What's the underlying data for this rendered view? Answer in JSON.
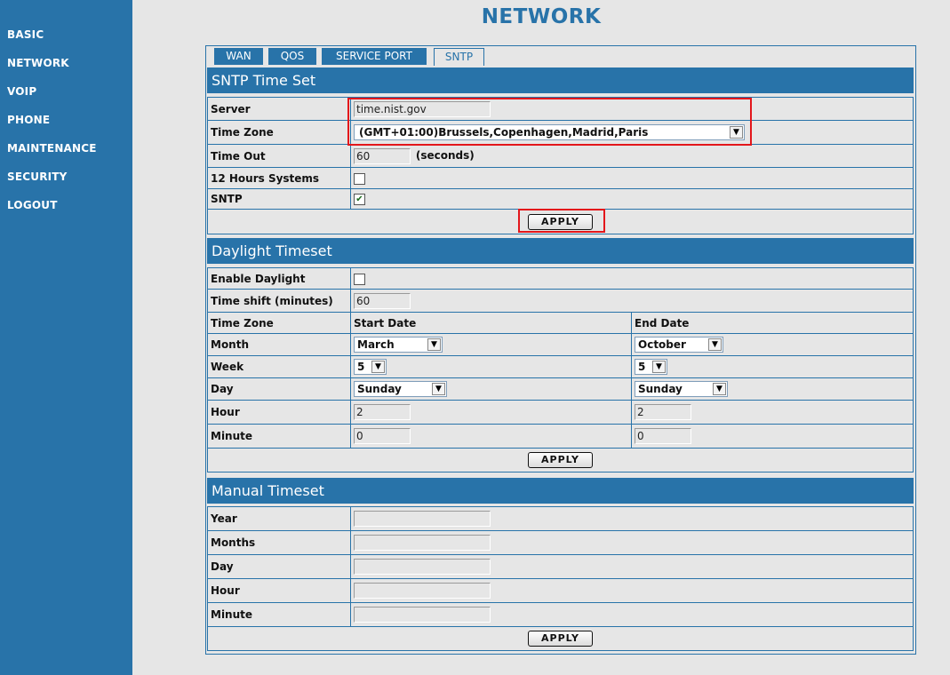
{
  "page_title": "NETWORK",
  "sidebar": {
    "items": [
      "BASIC",
      "NETWORK",
      "VOIP",
      "PHONE",
      "MAINTENANCE",
      "SECURITY",
      "LOGOUT"
    ]
  },
  "tabs": [
    {
      "label": "WAN",
      "active": false
    },
    {
      "label": "QOS",
      "active": false
    },
    {
      "label": "SERVICE PORT",
      "active": false
    },
    {
      "label": "SNTP",
      "active": true
    }
  ],
  "sntp": {
    "title": "SNTP Time Set",
    "server_label": "Server",
    "server_value": "time.nist.gov",
    "timezone_label": "Time Zone",
    "timezone_value": "(GMT+01:00)Brussels,Copenhagen,Madrid,Paris",
    "timeout_label": "Time Out",
    "timeout_value": "60",
    "timeout_unit": "(seconds)",
    "twelve_hours_label": "12 Hours Systems",
    "twelve_hours_checked": false,
    "sntp_label": "SNTP",
    "sntp_checked": true,
    "apply_label": "APPLY"
  },
  "daylight": {
    "title": "Daylight Timeset",
    "enable_label": "Enable Daylight",
    "enable_checked": false,
    "shift_label": "Time shift (minutes)",
    "shift_value": "60",
    "tz_label": "Time Zone",
    "start_header": "Start Date",
    "end_header": "End Date",
    "month_label": "Month",
    "start_month": "March",
    "end_month": "October",
    "week_label": "Week",
    "start_week": "5",
    "end_week": "5",
    "day_label": "Day",
    "start_day": "Sunday",
    "end_day": "Sunday",
    "hour_label": "Hour",
    "start_hour": "2",
    "end_hour": "2",
    "minute_label": "Minute",
    "start_minute": "0",
    "end_minute": "0",
    "apply_label": "APPLY"
  },
  "manual": {
    "title": "Manual Timeset",
    "year_label": "Year",
    "months_label": "Months",
    "day_label": "Day",
    "hour_label": "Hour",
    "minute_label": "Minute",
    "apply_label": "APPLY"
  },
  "colors": {
    "brand_blue": "#2873a9",
    "background": "#e6e6e6",
    "highlight_red": "#e3161b"
  }
}
